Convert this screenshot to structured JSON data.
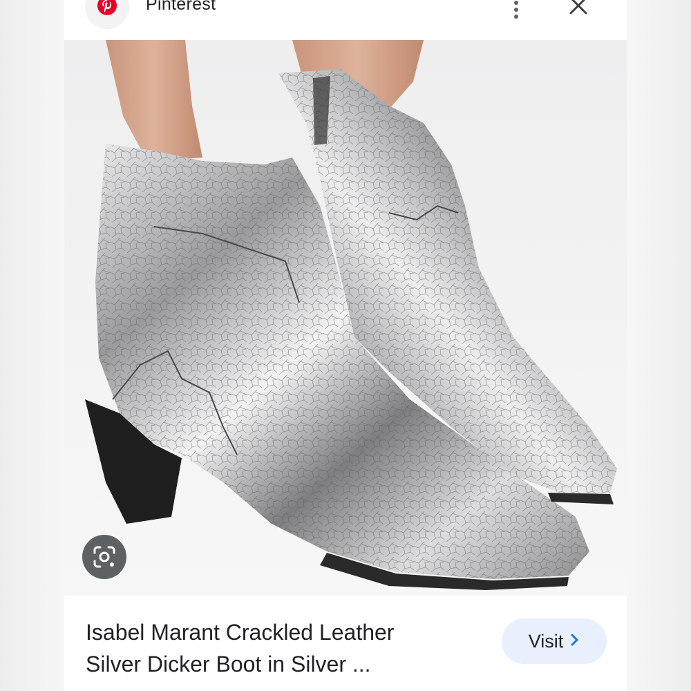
{
  "header": {
    "source_name": "Pinterest",
    "source_icon": "pinterest-logo-icon",
    "brand_color": "#E60023",
    "more_icon": "more-vert-icon",
    "close_icon": "close-icon"
  },
  "photo": {
    "lens_icon": "google-lens-icon"
  },
  "result": {
    "title_line1": "Isabel Marant Crackled Leather",
    "title_line2": "Silver Dicker Boot in Silver ...",
    "visit_label": "Visit",
    "visit_icon": "chevron-right-icon",
    "visit_button_color": "#E8F0FE",
    "accent_color": "#1A73E8"
  }
}
